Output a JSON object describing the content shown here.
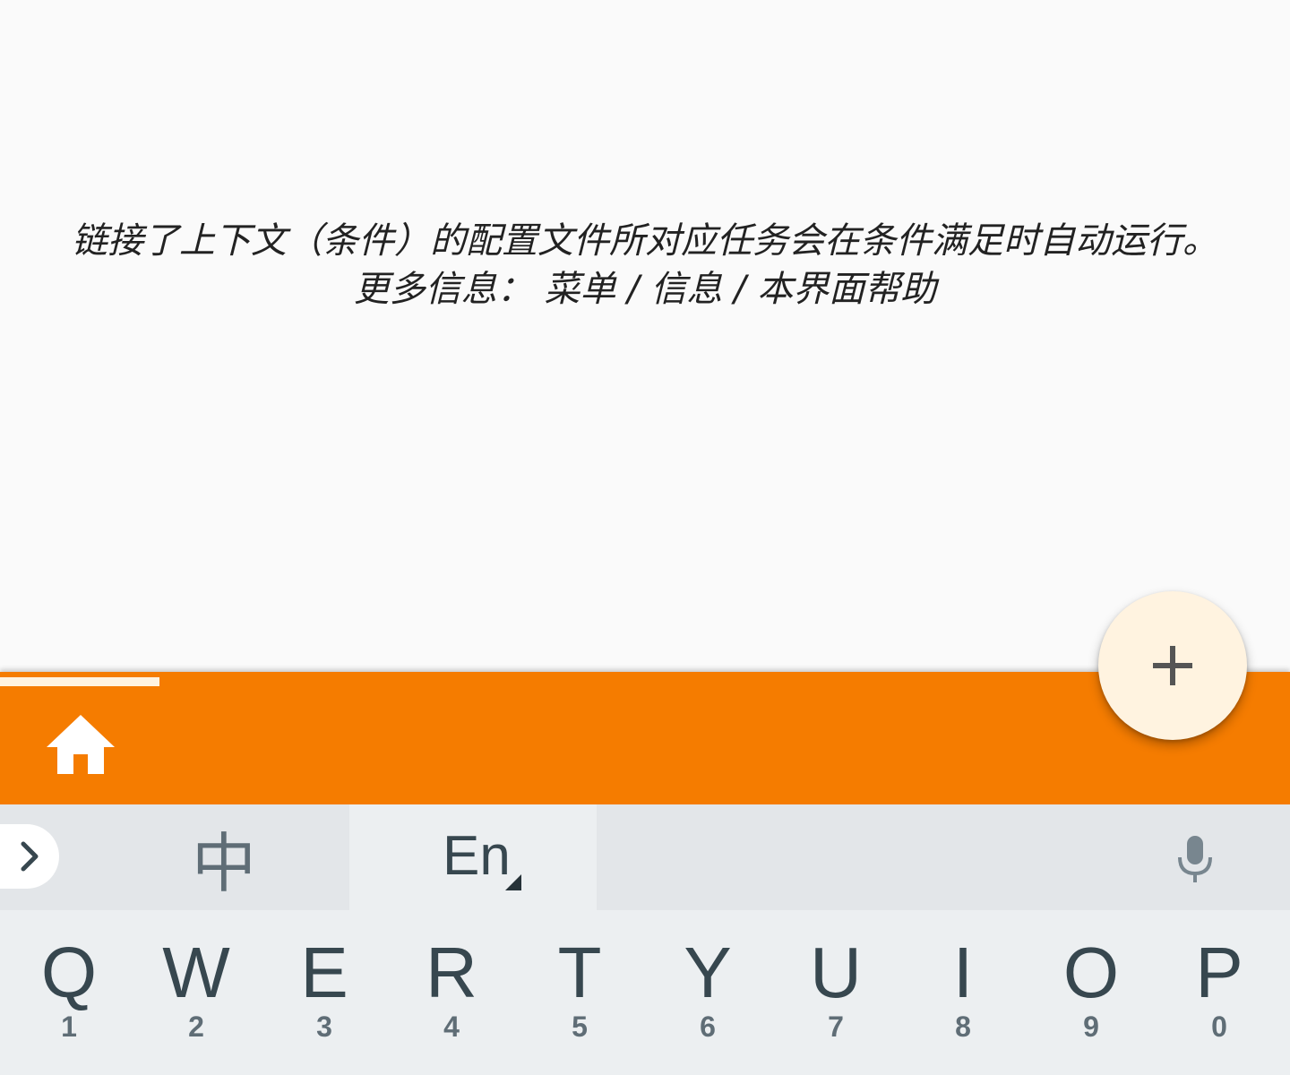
{
  "help": {
    "line1": "链接了上下文（条件）的配置文件所对应任务会在条件满足时自动运行。",
    "line2": "更多信息：  菜单 / 信息 / 本界面帮助"
  },
  "app_bar": {
    "color": "#f57c00",
    "home_icon": "home-icon"
  },
  "fab": {
    "icon": "plus-icon",
    "color": "#fff3e0"
  },
  "keyboard": {
    "toolbar": {
      "collapse_icon": "chevron-right-icon",
      "lang_zh": "中",
      "lang_en": "En",
      "mic_icon": "microphone-icon"
    },
    "keys": [
      {
        "letter": "Q",
        "num": "1"
      },
      {
        "letter": "W",
        "num": "2"
      },
      {
        "letter": "E",
        "num": "3"
      },
      {
        "letter": "R",
        "num": "4"
      },
      {
        "letter": "T",
        "num": "5"
      },
      {
        "letter": "Y",
        "num": "6"
      },
      {
        "letter": "U",
        "num": "7"
      },
      {
        "letter": "I",
        "num": "8"
      },
      {
        "letter": "O",
        "num": "9"
      },
      {
        "letter": "P",
        "num": "0"
      }
    ]
  }
}
